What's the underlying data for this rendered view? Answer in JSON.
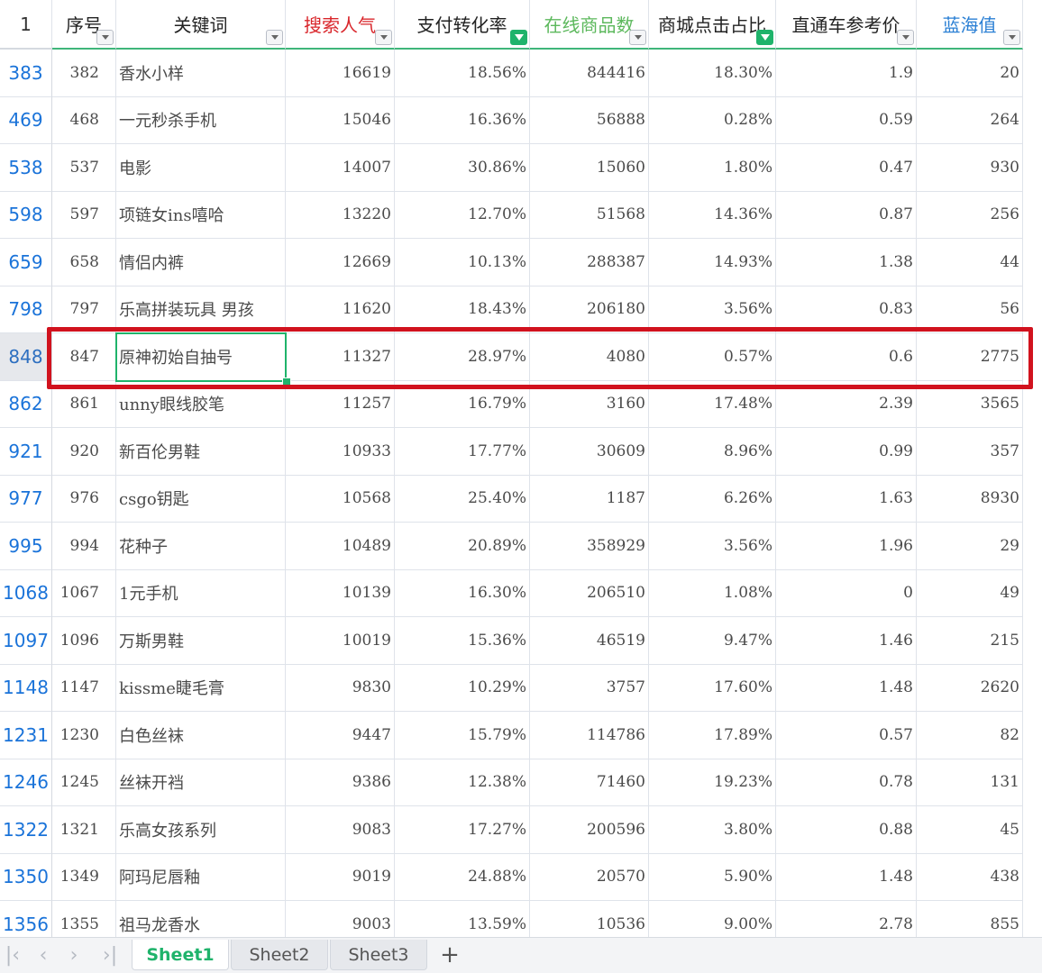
{
  "corner_label": "1",
  "headers": [
    {
      "label": "序号",
      "color": "#222222",
      "filter": false
    },
    {
      "label": "关键词",
      "color": "#222222",
      "filter": false
    },
    {
      "label": "搜索人气",
      "color": "#d9262b",
      "filter": false
    },
    {
      "label": "支付转化率",
      "color": "#222222",
      "filter": true
    },
    {
      "label": "在线商品数",
      "color": "#5cb85c",
      "filter": false
    },
    {
      "label": "商城点击占比",
      "color": "#222222",
      "filter": true
    },
    {
      "label": "直通车参考价",
      "color": "#222222",
      "filter": false
    },
    {
      "label": "蓝海值",
      "color": "#2a7fd4",
      "filter": false
    }
  ],
  "rows": [
    {
      "row": "383",
      "cells": [
        "382",
        "香水小样",
        "16619",
        "18.56%",
        "844416",
        "18.30%",
        "1.9",
        "20"
      ]
    },
    {
      "row": "469",
      "cells": [
        "468",
        "一元秒杀手机",
        "15046",
        "16.36%",
        "56888",
        "0.28%",
        "0.59",
        "264"
      ]
    },
    {
      "row": "538",
      "cells": [
        "537",
        "电影",
        "14007",
        "30.86%",
        "15060",
        "1.80%",
        "0.47",
        "930"
      ]
    },
    {
      "row": "598",
      "cells": [
        "597",
        "项链女ins嘻哈",
        "13220",
        "12.70%",
        "51568",
        "14.36%",
        "0.87",
        "256"
      ]
    },
    {
      "row": "659",
      "cells": [
        "658",
        "情侣内裤",
        "12669",
        "10.13%",
        "288387",
        "14.93%",
        "1.38",
        "44"
      ]
    },
    {
      "row": "798",
      "cells": [
        "797",
        "乐高拼装玩具 男孩",
        "11620",
        "18.43%",
        "206180",
        "3.56%",
        "0.83",
        "56"
      ]
    },
    {
      "row": "848",
      "cells": [
        "847",
        "原神初始自抽号",
        "11327",
        "28.97%",
        "4080",
        "0.57%",
        "0.6",
        "2775"
      ],
      "active": true
    },
    {
      "row": "862",
      "cells": [
        "861",
        "unny眼线胶笔",
        "11257",
        "16.79%",
        "3160",
        "17.48%",
        "2.39",
        "3565"
      ]
    },
    {
      "row": "921",
      "cells": [
        "920",
        "新百伦男鞋",
        "10933",
        "17.77%",
        "30609",
        "8.96%",
        "0.99",
        "357"
      ]
    },
    {
      "row": "977",
      "cells": [
        "976",
        "csgo钥匙",
        "10568",
        "25.40%",
        "1187",
        "6.26%",
        "1.63",
        "8930"
      ]
    },
    {
      "row": "995",
      "cells": [
        "994",
        "花种子",
        "10489",
        "20.89%",
        "358929",
        "3.56%",
        "1.96",
        "29"
      ]
    },
    {
      "row": "1068",
      "cells": [
        "1067",
        "1元手机",
        "10139",
        "16.30%",
        "206510",
        "1.08%",
        "0",
        "49"
      ]
    },
    {
      "row": "1097",
      "cells": [
        "1096",
        "万斯男鞋",
        "10019",
        "15.36%",
        "46519",
        "9.47%",
        "1.46",
        "215"
      ]
    },
    {
      "row": "1148",
      "cells": [
        "1147",
        "kissme睫毛膏",
        "9830",
        "10.29%",
        "3757",
        "17.60%",
        "1.48",
        "2620"
      ]
    },
    {
      "row": "1231",
      "cells": [
        "1230",
        "白色丝袜",
        "9447",
        "15.79%",
        "114786",
        "17.89%",
        "0.57",
        "82"
      ]
    },
    {
      "row": "1246",
      "cells": [
        "1245",
        "丝袜开裆",
        "9386",
        "12.38%",
        "71460",
        "19.23%",
        "0.78",
        "131"
      ]
    },
    {
      "row": "1322",
      "cells": [
        "1321",
        "乐高女孩系列",
        "9083",
        "17.27%",
        "200596",
        "3.80%",
        "0.88",
        "45"
      ]
    },
    {
      "row": "1350",
      "cells": [
        "1349",
        "阿玛尼唇釉",
        "9019",
        "24.88%",
        "20570",
        "5.90%",
        "1.48",
        "438"
      ]
    },
    {
      "row": "1356",
      "cells": [
        "1355",
        "祖马龙香水",
        "9003",
        "13.59%",
        "10536",
        "9.00%",
        "2.78",
        "855"
      ]
    }
  ],
  "tabs": {
    "first_icon": "first-sheet-icon",
    "prev_icon": "prev-sheet-icon",
    "next_icon": "next-sheet-icon",
    "last_icon": "last-sheet-icon",
    "sheets": [
      {
        "label": "Sheet1",
        "active": true
      },
      {
        "label": "Sheet2",
        "active": false
      },
      {
        "label": "Sheet3",
        "active": false
      }
    ],
    "add_label": "+"
  },
  "colors": {
    "accent": "#1fb36b",
    "highlight_box": "#d1121e",
    "row_number": "#1a73d9"
  }
}
